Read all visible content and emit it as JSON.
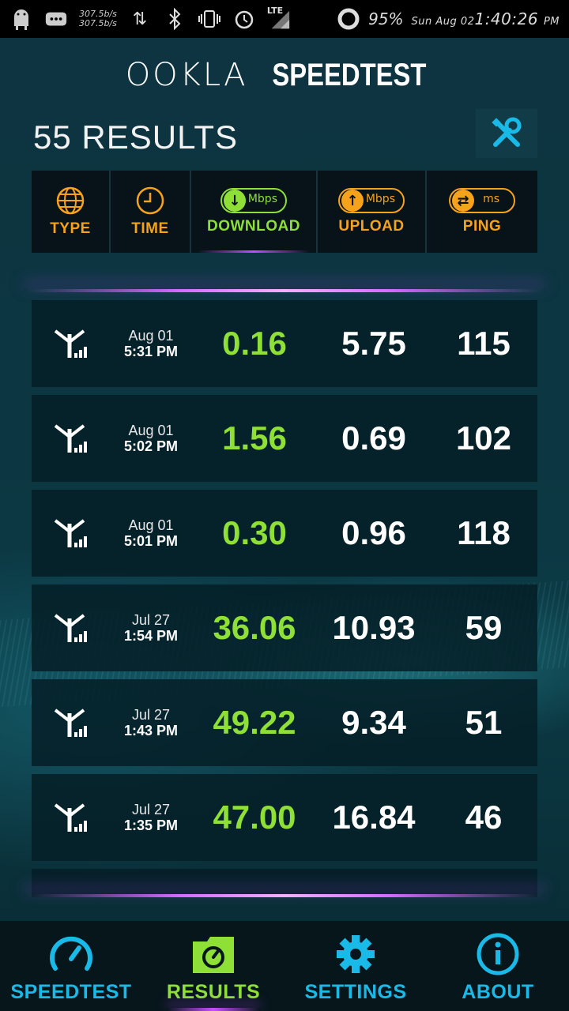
{
  "status_bar": {
    "net_up": "307.5b/s",
    "net_down": "307.5b/s",
    "network_type": "LTE",
    "battery": "95%",
    "date": "Sun Aug 02",
    "time": "1:40:26",
    "ampm": "PM"
  },
  "header": {
    "brand_ookla": "OOKLA",
    "brand_speedtest": "SPEEDTEST",
    "results_count": "55 RESULTS"
  },
  "columns": {
    "type": "TYPE",
    "time": "TIME",
    "download": "DOWNLOAD",
    "download_unit": "Mbps",
    "upload": "UPLOAD",
    "upload_unit": "Mbps",
    "ping": "PING",
    "ping_unit": "ms"
  },
  "results": [
    {
      "date": "Aug 01",
      "time": "5:31 PM",
      "download": "0.16",
      "upload": "5.75",
      "ping": "115"
    },
    {
      "date": "Aug 01",
      "time": "5:02 PM",
      "download": "1.56",
      "upload": "0.69",
      "ping": "102"
    },
    {
      "date": "Aug 01",
      "time": "5:01 PM",
      "download": "0.30",
      "upload": "0.96",
      "ping": "118"
    },
    {
      "date": "Jul 27",
      "time": "1:54 PM",
      "download": "36.06",
      "upload": "10.93",
      "ping": "59"
    },
    {
      "date": "Jul 27",
      "time": "1:43 PM",
      "download": "49.22",
      "upload": "9.34",
      "ping": "51"
    },
    {
      "date": "Jul 27",
      "time": "1:35 PM",
      "download": "47.00",
      "upload": "16.84",
      "ping": "46"
    }
  ],
  "nav": {
    "speedtest": "SPEEDTEST",
    "results": "RESULTS",
    "settings": "SETTINGS",
    "about": "ABOUT"
  },
  "colors": {
    "accent_orange": "#f7a21b",
    "accent_green": "#8ee037",
    "accent_blue": "#19b9e8",
    "glow_purple": "#c64dff"
  }
}
